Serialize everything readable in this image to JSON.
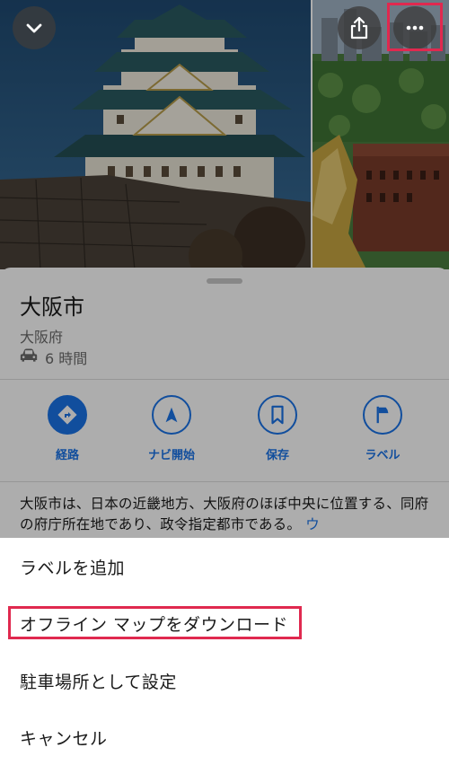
{
  "header": {
    "collapse_icon": "chevron-down-icon",
    "share_icon": "share-icon",
    "more_icon": "more-horiz-icon"
  },
  "place": {
    "title": "大阪市",
    "subtitle": "大阪府",
    "drive_icon": "car-icon",
    "drive_time": "6 時間"
  },
  "actions": [
    {
      "label": "経路",
      "icon": "directions-icon"
    },
    {
      "label": "ナビ開始",
      "icon": "navigation-icon"
    },
    {
      "label": "保存",
      "icon": "bookmark-icon"
    },
    {
      "label": "ラベル",
      "icon": "flag-icon"
    }
  ],
  "description": {
    "text": "大阪市は、日本の近畿地方、大阪府のほぼ中央に位置する、同府の府庁所在地であり、政令指定都市である。",
    "more": "ウ"
  },
  "menu": {
    "items": [
      "ラベルを追加",
      "オフライン マップをダウンロード",
      "駐車場所として設定",
      "キャンセル"
    ]
  },
  "colors": {
    "accent": "#1a73e8",
    "highlight": "#e0294f"
  }
}
